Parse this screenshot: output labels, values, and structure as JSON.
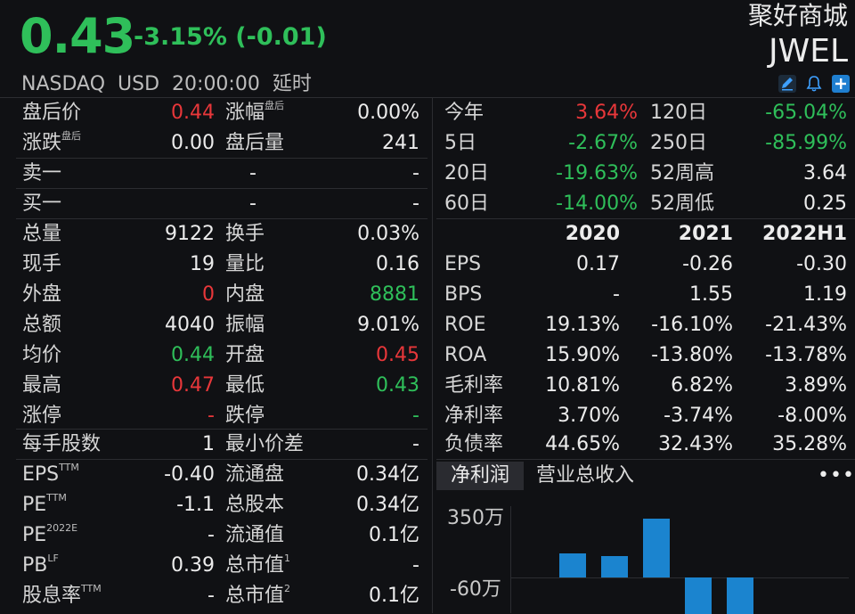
{
  "header": {
    "price": "0.43",
    "change": "-3.15% (-0.01)",
    "exchange": "NASDAQ",
    "currency": "USD",
    "time": "20:00:00",
    "delay": "延时",
    "company_name": "聚好商城",
    "ticker": "JWEL",
    "icons": [
      "edit-icon",
      "bell-icon",
      "add-icon"
    ]
  },
  "left": {
    "r1": {
      "l1": "盘后价",
      "v1": "0.44",
      "l2": "涨幅",
      "l2_sup": "盘后",
      "v2": "0.00%"
    },
    "r2": {
      "l1": "涨跌",
      "l1_sup": "盘后",
      "v1": "0.00",
      "l2": "盘后量",
      "v2": "241"
    },
    "sell": {
      "label": "卖一",
      "v1": "-",
      "v2": "-"
    },
    "buy": {
      "label": "买一",
      "v1": "-",
      "v2": "-"
    },
    "r5": {
      "l1": "总量",
      "v1": "9122",
      "l2": "换手",
      "v2": "0.03%"
    },
    "r6": {
      "l1": "现手",
      "v1": "19",
      "l2": "量比",
      "v2": "0.16"
    },
    "r7": {
      "l1": "外盘",
      "v1": "0",
      "l2": "内盘",
      "v2": "8881"
    },
    "r8": {
      "l1": "总额",
      "v1": "4040",
      "l2": "振幅",
      "v2": "9.01%"
    },
    "r9": {
      "l1": "均价",
      "v1": "0.44",
      "l2": "开盘",
      "v2": "0.45"
    },
    "r10": {
      "l1": "最高",
      "v1": "0.47",
      "l2": "最低",
      "v2": "0.43"
    },
    "r11": {
      "l1": "涨停",
      "v1": "-",
      "l2": "跌停",
      "v2": "-"
    },
    "r12": {
      "l1": "每手股数",
      "v1": "1",
      "l2": "最小价差",
      "v2": "-"
    },
    "r13": {
      "l1": "EPS",
      "l1_sup": "TTM",
      "v1": "-0.40",
      "l2": "流通盘",
      "v2": "0.34亿"
    },
    "r14": {
      "l1": "PE",
      "l1_sup": "TTM",
      "v1": "-1.1",
      "l2": "总股本",
      "v2": "0.34亿"
    },
    "r15": {
      "l1": "PE",
      "l1_sup": "2022E",
      "v1": "-",
      "l2": "流通值",
      "v2": "0.1亿"
    },
    "r16": {
      "l1": "PB",
      "l1_sup": "LF",
      "v1": "0.39",
      "l2": "总市值",
      "l2_sup": "1",
      "v2": "-"
    },
    "r17": {
      "l1": "股息率",
      "l1_sup": "TTM",
      "v1": "-",
      "l2": "总市值",
      "l2_sup": "2",
      "v2": "0.1亿"
    }
  },
  "right": {
    "perf": [
      {
        "l1": "今年",
        "v1": "3.64%",
        "l2": "120日",
        "v2": "-65.04%"
      },
      {
        "l1": "5日",
        "v1": "-2.67%",
        "l2": "250日",
        "v2": "-85.99%"
      },
      {
        "l1": "20日",
        "v1": "-19.63%",
        "l2": "52周高",
        "v2": "3.64"
      },
      {
        "l1": "60日",
        "v1": "-14.00%",
        "l2": "52周低",
        "v2": "0.25"
      }
    ],
    "fin_headers": [
      "2020",
      "2021",
      "2022H1"
    ],
    "fin_rows": [
      {
        "label": "EPS",
        "v": [
          "0.17",
          "-0.26",
          "-0.30"
        ]
      },
      {
        "label": "BPS",
        "v": [
          "-",
          "1.55",
          "1.19"
        ]
      },
      {
        "label": "ROE",
        "v": [
          "19.13%",
          "-16.10%",
          "-21.43%"
        ]
      },
      {
        "label": "ROA",
        "v": [
          "15.90%",
          "-13.80%",
          "-13.78%"
        ]
      },
      {
        "label": "毛利率",
        "v": [
          "10.81%",
          "6.82%",
          "3.89%"
        ]
      },
      {
        "label": "净利率",
        "v": [
          "3.70%",
          "-3.74%",
          "-8.00%"
        ]
      },
      {
        "label": "负债率",
        "v": [
          "44.65%",
          "32.43%",
          "35.28%"
        ]
      }
    ],
    "tabs": {
      "net_profit": "净利润",
      "revenue": "营业总收入",
      "more": "•••"
    },
    "chart_axis": {
      "top": "350万",
      "bottom": "-60万"
    }
  },
  "chart_data": {
    "type": "bar",
    "ylim_labels": [
      "350万",
      "-60万"
    ],
    "values_relative": [
      0.33,
      0.29,
      0.81,
      -0.5,
      -0.5
    ],
    "colors": {
      "bar": "#1b84cf"
    }
  },
  "colors": {
    "up": "#e8373a",
    "down": "#2fbf5a",
    "background": "#101114"
  }
}
